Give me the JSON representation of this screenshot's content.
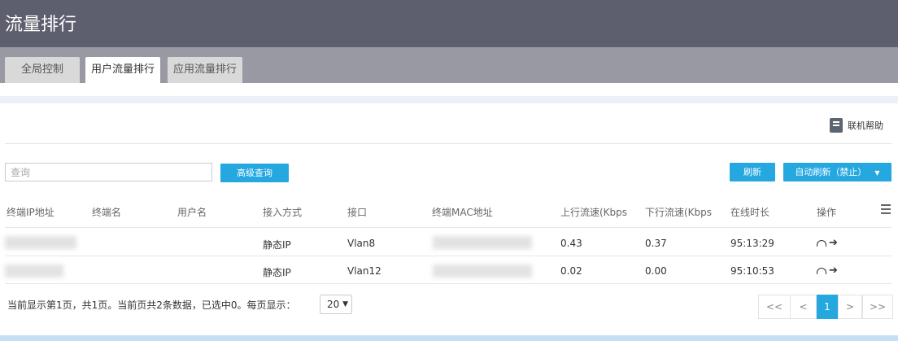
{
  "header": {
    "title": "流量排行"
  },
  "tabs": [
    {
      "label": "全局控制",
      "active": false
    },
    {
      "label": "用户流量排行",
      "active": true
    },
    {
      "label": "应用流量排行",
      "active": false
    }
  ],
  "help": {
    "label": "联机帮助",
    "icon": "book-icon"
  },
  "toolbar": {
    "search_placeholder": "查询",
    "advanced_query": "高级查询",
    "refresh": "刷新",
    "auto_refresh": "自动刷新（禁止）"
  },
  "table": {
    "columns": [
      "终端IP地址",
      "终端名",
      "用户名",
      "接入方式",
      "接口",
      "终端MAC地址",
      "上行流速(Kbps",
      "下行流速(Kbps",
      "在线时长",
      "操作"
    ],
    "rows": [
      {
        "ip": "",
        "name": "",
        "user": "",
        "access": "静态IP",
        "interface": "Vlan8",
        "mac": "",
        "up": "0.43",
        "down": "0.37",
        "duration": "95:13:29"
      },
      {
        "ip": "",
        "name": "",
        "user": "",
        "access": "静态IP",
        "interface": "Vlan12",
        "mac": "",
        "up": "0.02",
        "down": "0.00",
        "duration": "95:10:53"
      }
    ]
  },
  "footer": {
    "summary": "当前显示第1页，共1页。当前页共2条数据，已选中0。每页显示：",
    "page_size": "20"
  },
  "pagination": {
    "first": "<<",
    "prev": "<",
    "current": "1",
    "next": ">",
    "last": ">>"
  },
  "colors": {
    "header_bg": "#5e5f6e",
    "tab_strip_bg": "#9899a2",
    "accent": "#25a8e0"
  }
}
